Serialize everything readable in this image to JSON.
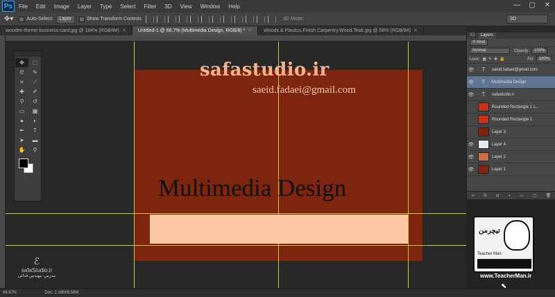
{
  "menubar": {
    "logo": "Ps",
    "items": [
      "File",
      "Edit",
      "Image",
      "Layer",
      "Type",
      "Select",
      "Filter",
      "3D",
      "View",
      "Window",
      "Help"
    ],
    "controls": [
      "—",
      "▢",
      "✕"
    ]
  },
  "options": {
    "auto_select_label": "Auto-Select:",
    "auto_select_value": "Layer",
    "transform_label": "Show Transform Controls",
    "mode3d_label": "3D Mode:",
    "workspace": "3D"
  },
  "tabs": [
    {
      "label": "wooden-theme-business-card.jpg @ 184% (RGB/8#)",
      "active": false
    },
    {
      "label": "Untitled-1 @ 66.7% (Multimedia Design, RGB/8) *",
      "active": true
    },
    {
      "label": "Woods & Plastics.Finish Carpentry.Wood.Teak.jpg @ 58% (RGB/8#)",
      "active": false
    }
  ],
  "canvas": {
    "title": "safastudio.ir",
    "email": "saeid.fadaei@gmail.com",
    "banner": "Multimedia Design",
    "colors": {
      "card": "#7e2510",
      "banner": "#fcc6a6",
      "guide": "#cfc545"
    }
  },
  "tools": [
    {
      "name": "move-tool",
      "glyph": "✥"
    },
    {
      "name": "marquee-tool",
      "glyph": "⬚"
    },
    {
      "name": "lasso-tool",
      "glyph": "ᘓ"
    },
    {
      "name": "quick-select-tool",
      "glyph": "✎"
    },
    {
      "name": "crop-tool",
      "glyph": "⌗"
    },
    {
      "name": "eyedropper-tool",
      "glyph": "⟋"
    },
    {
      "name": "healing-brush-tool",
      "glyph": "✚"
    },
    {
      "name": "brush-tool",
      "glyph": "✐"
    },
    {
      "name": "clone-stamp-tool",
      "glyph": "⚲"
    },
    {
      "name": "history-brush-tool",
      "glyph": "↺"
    },
    {
      "name": "eraser-tool",
      "glyph": "▭"
    },
    {
      "name": "gradient-tool",
      "glyph": "▦"
    },
    {
      "name": "blur-tool",
      "glyph": "●"
    },
    {
      "name": "dodge-tool",
      "glyph": "◐"
    },
    {
      "name": "pen-tool",
      "glyph": "✒"
    },
    {
      "name": "type-tool",
      "glyph": "T"
    },
    {
      "name": "path-select-tool",
      "glyph": "➤"
    },
    {
      "name": "shape-tool",
      "glyph": "▬"
    },
    {
      "name": "hand-tool",
      "glyph": "✋"
    },
    {
      "name": "zoom-tool",
      "glyph": "⚲"
    }
  ],
  "layers_panel": {
    "tabs": [
      "3D",
      "Layers"
    ],
    "filter": "Kind",
    "blend_mode": "Normal",
    "opacity_label": "Opacity:",
    "opacity": "100%",
    "lock_label": "Lock:",
    "fill_label": "Fill:",
    "fill": "100%",
    "layers": [
      {
        "name": "saeid.fadaei@gmail.com",
        "kind": "text",
        "visible": true,
        "selected": false,
        "thumb": ""
      },
      {
        "name": "Multimedia Design",
        "kind": "text",
        "visible": true,
        "selected": true,
        "thumb": ""
      },
      {
        "name": "safastudio.ir",
        "kind": "text",
        "visible": true,
        "selected": false,
        "thumb": ""
      },
      {
        "name": "Rounded Rectangle 1 c...",
        "kind": "shape",
        "visible": false,
        "selected": false,
        "thumb": "#c7331a"
      },
      {
        "name": "Rounded Rectangle 1",
        "kind": "shape",
        "visible": false,
        "selected": false,
        "thumb": "#c7331a"
      },
      {
        "name": "Layer 3",
        "kind": "pixel",
        "visible": false,
        "selected": false,
        "thumb": "#7e2510"
      },
      {
        "name": "Layer 4",
        "kind": "pixel",
        "visible": true,
        "selected": false,
        "thumb": "#e8e8e8"
      },
      {
        "name": "Layer 2",
        "kind": "pixel",
        "visible": true,
        "selected": false,
        "thumb": "#c8704c"
      },
      {
        "name": "Layer 1",
        "kind": "pixel",
        "visible": true,
        "selected": false,
        "thumb": "#7e2510"
      }
    ],
    "footer_icons": [
      "link-icon",
      "fx-icon",
      "mask-icon",
      "adjustment-icon",
      "folder-icon",
      "new-layer-icon",
      "trash-icon"
    ]
  },
  "status": {
    "zoom": "66.67%",
    "doc": "Doc: 2.16M/8.58M"
  },
  "watermarks": {
    "left_logo": "ℰ",
    "left_name": "safaStudio.ir",
    "left_sub": "مدرس: مهندس فدائی",
    "right_badge": "تیچرمن",
    "right_sub": "Teacher Man",
    "right_url": "www.TeacherMan.ir"
  }
}
